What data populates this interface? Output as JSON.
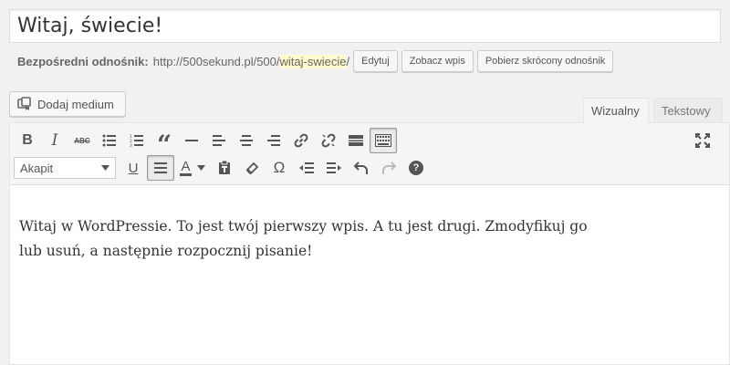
{
  "post": {
    "title": "Witaj, świecie!"
  },
  "permalink": {
    "label": "Bezpośredni odnośnik:",
    "base": "http://500sekund.pl/500/",
    "slug": "witaj-swiecie",
    "trail": "/",
    "edit_label": "Edytuj",
    "view_label": "Zobacz wpis",
    "shortlink_label": "Pobierz skrócony odnośnik"
  },
  "media": {
    "add_label": "Dodaj medium"
  },
  "tabs": {
    "visual": "Wizualny",
    "text": "Tekstowy"
  },
  "toolbar": {
    "format_select": "Akapit",
    "row1_icons": [
      "bold-icon",
      "italic-icon",
      "strikethrough-icon",
      "bullet-list-icon",
      "numbered-list-icon",
      "blockquote-icon",
      "horizontal-rule-icon",
      "align-left-icon",
      "align-center-icon",
      "align-right-icon",
      "link-icon",
      "unlink-icon",
      "read-more-icon",
      "toolbar-toggle-icon"
    ],
    "row2_icons": [
      "underline-icon",
      "justify-icon",
      "text-color-icon",
      "paste-text-icon",
      "clear-formatting-icon",
      "special-char-icon",
      "outdent-icon",
      "indent-icon",
      "undo-icon",
      "redo-icon",
      "help-icon"
    ],
    "bold_glyph": "B",
    "italic_glyph": "I",
    "strike_glyph": "ABC",
    "quote_glyph": "“",
    "underline_glyph": "U",
    "color_glyph": "A",
    "omega_glyph": "Ω",
    "help_glyph": "?"
  },
  "content": {
    "body": "Witaj w WordPressie. To jest twój pierwszy wpis. A tu jest drugi. Zmodyfikuj go lub usuń, a następnie rozpocznij pisanie!"
  }
}
